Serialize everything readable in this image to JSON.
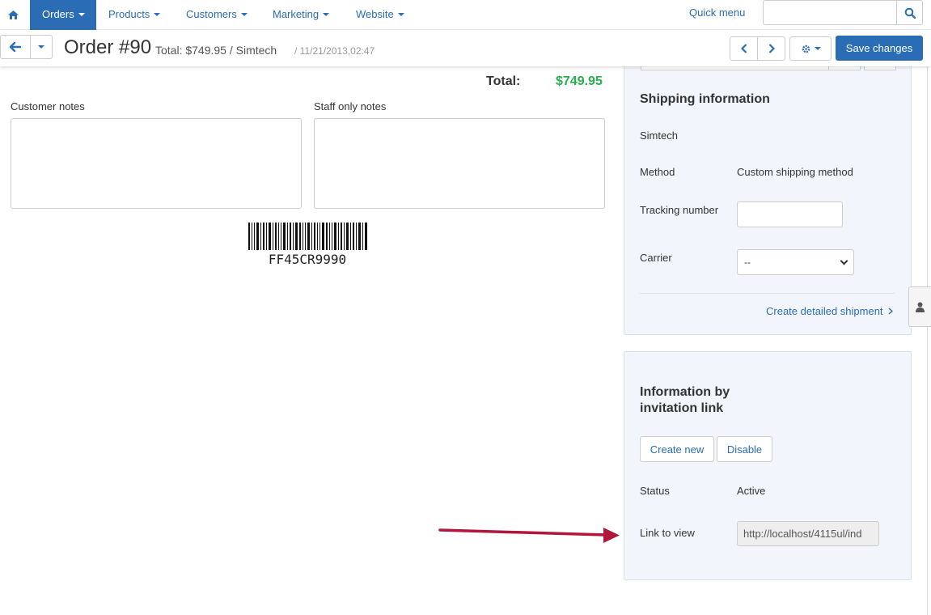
{
  "nav": {
    "home_icon": "home-icon",
    "items": [
      {
        "label": "Orders",
        "active": true
      },
      {
        "label": "Products",
        "active": false
      },
      {
        "label": "Customers",
        "active": false
      },
      {
        "label": "Marketing",
        "active": false
      },
      {
        "label": "Website",
        "active": false
      }
    ],
    "quick_menu": "Quick menu",
    "search_placeholder": ""
  },
  "header": {
    "title": "Order #90",
    "subtitle": "Total: $749.95 / Simtech",
    "date": "/ 11/21/2013,02:47",
    "save_label": "Save changes"
  },
  "order": {
    "total_label": "Total:",
    "total_value": "$749.95",
    "customer_notes_label": "Customer notes",
    "staff_notes_label": "Staff only notes",
    "barcode_text": "FF45CR9990"
  },
  "shipping": {
    "title": "Shipping information",
    "company": "Simtech",
    "method_label": "Method",
    "method_value": "Custom shipping method",
    "tracking_label": "Tracking number",
    "carrier_label": "Carrier",
    "carrier_value": "--",
    "create_shipment_link": "Create detailed shipment"
  },
  "invitation": {
    "title_line1": "Information by",
    "title_line2": "invitation link",
    "create_new_label": "Create new",
    "disable_label": "Disable",
    "status_label": "Status",
    "status_value": "Active",
    "link_label": "Link to view",
    "link_value": "http://localhost/4115ul/ind"
  },
  "colors": {
    "accent": "#2a6db5",
    "total_green": "#26b14e",
    "panel_bg": "#f2f6fc",
    "arrow_red": "#b0173a"
  }
}
